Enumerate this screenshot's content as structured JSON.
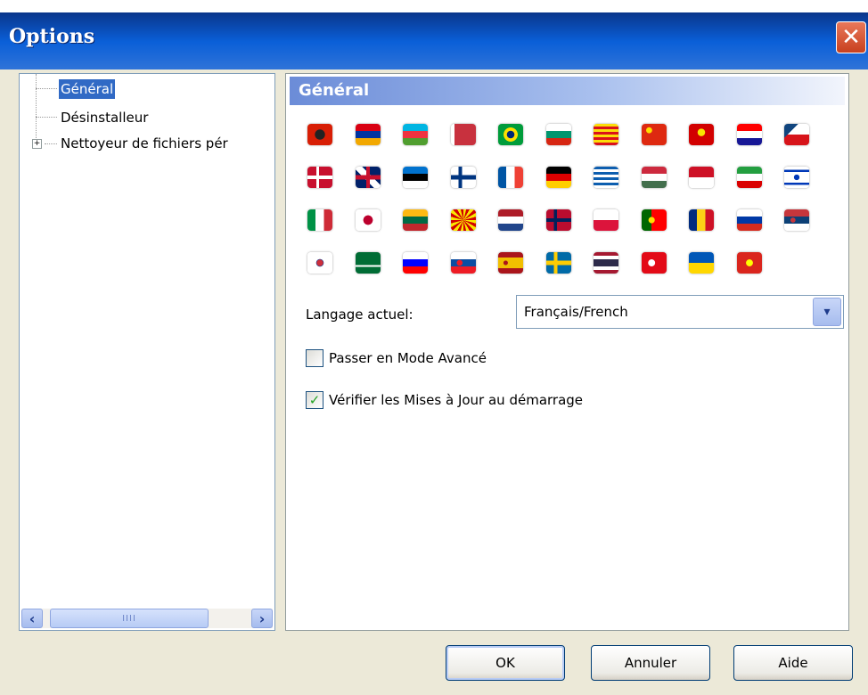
{
  "window": {
    "title": "Options",
    "close_icon": "close-icon"
  },
  "tree": {
    "items": [
      {
        "label": "Général",
        "selected": true
      },
      {
        "label": "Désinstalleur",
        "selected": false
      },
      {
        "label": "Nettoyeur de fichiers pér",
        "selected": false,
        "expandable": true
      }
    ],
    "scrollbar_grip": "IIII"
  },
  "panel": {
    "header": "Général",
    "flags": [
      "albania",
      "armenia",
      "azerbaijan",
      "belarus",
      "brazil",
      "bulgaria",
      "catalonia",
      "china",
      "macedonia-old",
      "croatia",
      "czech",
      "denmark",
      "uk",
      "estonia",
      "finland",
      "france",
      "germany",
      "greece",
      "hungary",
      "indonesia",
      "iran",
      "israel",
      "italy",
      "japan",
      "lithuania",
      "macedonia",
      "netherlands",
      "norway",
      "poland",
      "portugal",
      "romania",
      "russia",
      "serbia",
      "south-korea",
      "saudi-arabia",
      "slovenia",
      "slovakia",
      "spain",
      "sweden",
      "thailand",
      "turkey",
      "ukraine",
      "vietnam"
    ],
    "language_label": "Langage actuel:",
    "language_value": "Français/French",
    "advanced_mode_label": "Passer en Mode Avancé",
    "advanced_mode_checked": false,
    "check_updates_label": "Vérifier les Mises à Jour au démarrage",
    "check_updates_checked": true
  },
  "buttons": {
    "ok": "OK",
    "cancel": "Annuler",
    "help": "Aide"
  }
}
